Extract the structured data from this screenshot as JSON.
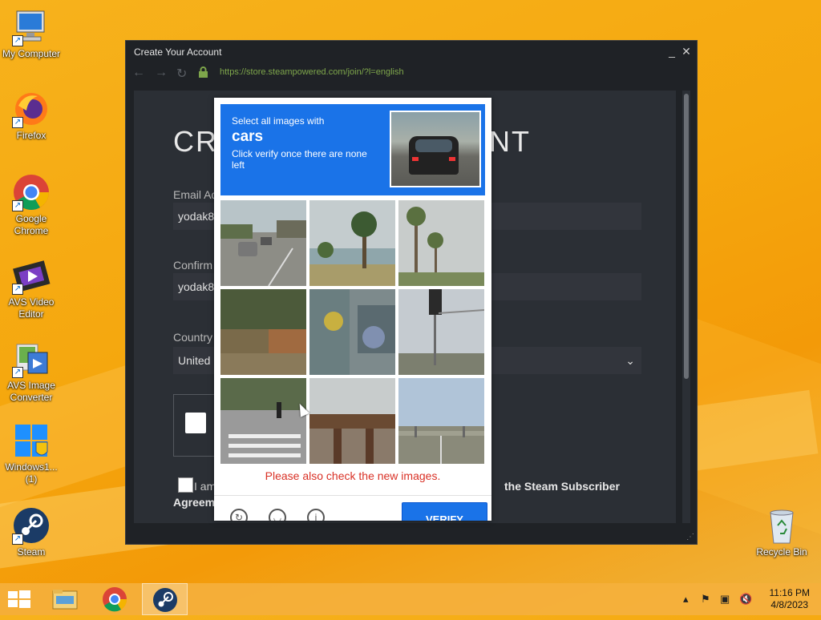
{
  "desktop": {
    "icons": [
      {
        "label": "My Computer",
        "icon": "computer-icon"
      },
      {
        "label": "Firefox",
        "icon": "firefox-icon"
      },
      {
        "label": "Google Chrome",
        "icon": "chrome-icon"
      },
      {
        "label": "AVS Video Editor",
        "icon": "avs-video-editor-icon"
      },
      {
        "label": "AVS Image Converter",
        "icon": "avs-image-converter-icon"
      },
      {
        "label": "Windows1... (1)",
        "icon": "windows-setup-icon"
      },
      {
        "label": "Steam",
        "icon": "steam-icon"
      },
      {
        "label": "Recycle Bin",
        "icon": "recycle-bin-icon"
      }
    ]
  },
  "window": {
    "title": "Create Your Account",
    "url": "https://store.steampowered.com/join/?l=english",
    "minimize": "_",
    "close": "✕"
  },
  "form": {
    "heading_left": "CRE",
    "heading_right": "NT",
    "email_label": "Email Ad",
    "email_value": "yodak8",
    "confirm_label": "Confirm",
    "confirm_value": "yodak8",
    "country_label": "Country",
    "country_value": "United",
    "agree_prefix": "I am",
    "agree_bold": "the Steam Subscriber",
    "agree_line2": "Agreem"
  },
  "captcha": {
    "prompt_line1": "Select all images with",
    "prompt_target": "cars",
    "prompt_line3": "Click verify once there are none left",
    "message": "Please also check the new images.",
    "verify_label": "VERIFY",
    "tiles": [
      "tile-road-with-cars",
      "tile-beach-palm",
      "tile-palm-trees",
      "tile-trees-fence",
      "tile-graffiti-wall",
      "tile-traffic-light",
      "tile-crosswalk",
      "tile-bridge",
      "tile-highway"
    ]
  },
  "taskbar": {
    "time": "11:16 PM",
    "date": "4/8/2023"
  }
}
